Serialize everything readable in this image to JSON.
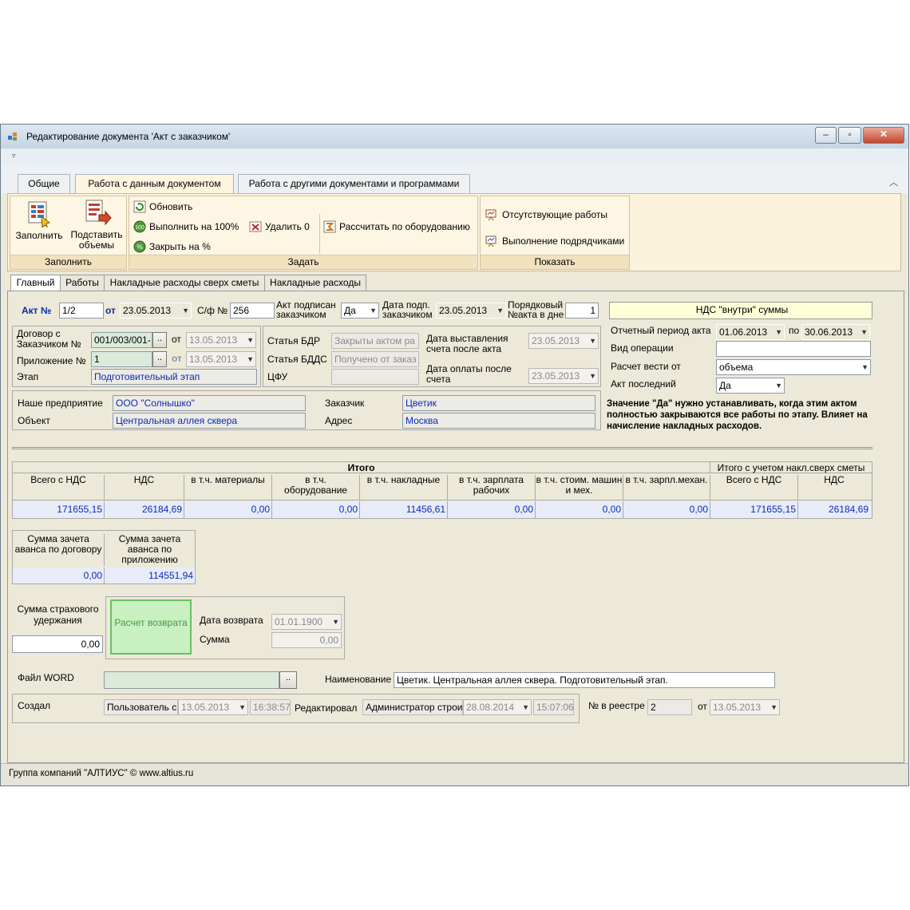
{
  "window": {
    "title": "Редактирование документа 'Акт с заказчиком'"
  },
  "ribbon_tabs": [
    "Общие",
    "Работа с данным документом",
    "Работа с другими документами и программами"
  ],
  "ribbon": {
    "fill_group": {
      "title": "Заполнить",
      "fill_label": "Заполнить",
      "insert_label_1": "Подставить",
      "insert_label_2": "объемы"
    },
    "set_group": {
      "title": "Задать",
      "refresh": "Обновить",
      "exec100": "Выполнить на 100%",
      "delete0": "Удалить 0",
      "close_pct": "Закрыть на %",
      "calc_equipment": "Рассчитать по оборудованию"
    },
    "show_group": {
      "title": "Показать",
      "missing_works": "Отсутствующие работы",
      "contractors": "Выполнение подрядчиками"
    }
  },
  "sub_tabs": [
    "Главный",
    "Работы",
    "Накладные расходы сверх сметы",
    "Накладные расходы"
  ],
  "act": {
    "act_no_label": "Акт №",
    "act_no": "1/2",
    "from_label": "от",
    "act_date": "23.05.2013",
    "sf_label": "С/ф №",
    "sf_no": "256",
    "signed_label_1": "Акт подписан",
    "signed_label_2": "заказчиком",
    "signed_value": "Да",
    "sign_date_label_1": "Дата подп.",
    "sign_date_label_2": "заказчиком",
    "sign_date": "23.05.2013",
    "order_label_1": "Порядковый",
    "order_label_2": "№акта в дне",
    "order_no": "1",
    "vat_inside": "НДС \"внутри\" суммы"
  },
  "contract": {
    "contract_label_1": "Договор с",
    "contract_label_2": "Заказчиком №",
    "contract_no": "001/003/001-",
    "contract_from": "от",
    "contract_date": "13.05.2013",
    "appendix_label": "Приложение №",
    "appendix_no": "1",
    "appendix_from": "от",
    "appendix_date": "13.05.2013",
    "stage_label": "Этап",
    "stage_value": "Подготовительный этап",
    "bdr_label": "Статья БДР",
    "bdr_value": "Закрыты актом ра",
    "bdds_label": "Статья БДДС",
    "bdds_value": "Получено от заказ",
    "cfu_label": "ЦФУ",
    "cfu_value": "",
    "invoice_date_label_1": "Дата выставления",
    "invoice_date_label_2": "счета после акта",
    "invoice_date": "23.05.2013",
    "pay_date_label_1": "Дата оплаты после",
    "pay_date_label_2": "счета",
    "pay_date": "23.05.2013"
  },
  "period": {
    "period_label": "Отчетный период акта",
    "period_from": "01.06.2013",
    "period_to_label": "по",
    "period_to": "30.06.2013",
    "operation_label": "Вид операции",
    "operation_value": "",
    "calc_label": "Расчет вести от",
    "calc_value": "объема",
    "last_label": "Акт последний",
    "last_value": "Да",
    "note": "Значение \"Да\" нужно устанавливать, когда этим актом полностью закрываются все работы по этапу. Влияет на начисление накладных расходов."
  },
  "company": {
    "enterprise_label": "Наше предприятие",
    "enterprise_value": "ООО \"Солнышко\"",
    "object_label": "Объект",
    "object_value": "Центральная аллея сквера",
    "customer_label": "Заказчик",
    "customer_value": "Цветик",
    "address_label": "Адрес",
    "address_value": "Москва"
  },
  "totals": {
    "group_title": "Итого",
    "group_title_2": "Итого с учетом накл.сверх сметы",
    "headers": [
      "Всего с НДС",
      "НДС",
      "в т.ч. материалы",
      "в т.ч. оборудование",
      "в т.ч. накладные",
      "в т.ч.  зарплата рабочих",
      "в т.ч. стоим. машин и мех.",
      "в т.ч. зарпл.механ.",
      "Всего с НДС",
      "НДС"
    ],
    "values": [
      "171655,15",
      "26184,69",
      "0,00",
      "0,00",
      "11456,61",
      "0,00",
      "0,00",
      "0,00",
      "171655,15",
      "26184,69"
    ]
  },
  "advance": {
    "contract_label": "Сумма зачета аванса по договору",
    "contract_value": "0,00",
    "appendix_label": "Сумма зачета аванса по приложению",
    "appendix_value": "114551,94"
  },
  "insurance": {
    "label": "Сумма страхового удержания",
    "value": "0,00",
    "refund_button": "Расчет возврата",
    "refund_date_label": "Дата возврата",
    "refund_date": "01.01.1900",
    "sum_label": "Сумма",
    "sum_value": "0,00"
  },
  "file": {
    "label": "Файл WORD",
    "value": "",
    "browse": "..",
    "name_label": "Наименование",
    "name_value": "Цветик. Центральная аллея сквера. Подготовительный этап."
  },
  "created": {
    "created_label": "Создал",
    "creator": "Пользователь с",
    "created_date": "13.05.2013",
    "created_time": "16:38:57",
    "edited_label": "Редактировал",
    "editor": "Администратор строи",
    "edited_date": "28.08.2014",
    "edited_time": "15:07:06",
    "registry_label": "№ в реестре",
    "registry_no": "2",
    "registry_from": "от",
    "registry_date": "13.05.2013"
  },
  "status_bar": {
    "text": "Группа компаний \"АЛТИУС\" © www.altius.ru"
  },
  "colors": {
    "ribbon_bg": "#fbf2dc",
    "value_blue": "#0a2bb5",
    "yellow_box": "#fefed7",
    "refund_green": "#c8f0c0"
  }
}
